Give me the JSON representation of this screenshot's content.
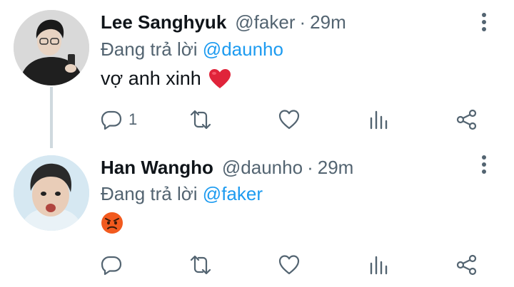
{
  "tweets": [
    {
      "name": "Lee Sanghyuk",
      "handle": "@faker",
      "separator": "·",
      "time": "29m",
      "replying_prefix": "Đang trả lời",
      "replying_to": "@daunho",
      "text": "vợ anh xinh",
      "emoji": "red-heart",
      "reply_count": "1"
    },
    {
      "name": "Han Wangho",
      "handle": "@daunho",
      "separator": "·",
      "time": "29m",
      "replying_prefix": "Đang trả lời",
      "replying_to": "@faker",
      "text": "",
      "emoji": "angry-face",
      "reply_count": ""
    }
  ],
  "colors": {
    "secondary_text": "#536471",
    "link": "#1d9bf0",
    "primary_text": "#0f1419",
    "thread_line": "#cfd9de"
  },
  "icons": [
    "reply-icon",
    "retweet-icon",
    "like-icon",
    "views-icon",
    "share-icon",
    "more-icon"
  ]
}
